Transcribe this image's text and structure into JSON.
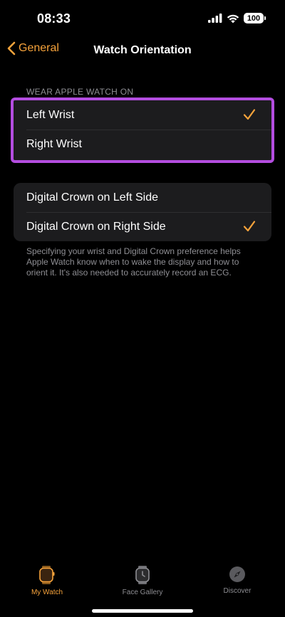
{
  "status": {
    "time": "08:33",
    "battery": "100"
  },
  "nav": {
    "back_label": "General",
    "title": "Watch Orientation"
  },
  "wrist_section": {
    "header": "WEAR APPLE WATCH ON",
    "options": [
      {
        "label": "Left Wrist",
        "selected": true
      },
      {
        "label": "Right Wrist",
        "selected": false
      }
    ]
  },
  "crown_section": {
    "options": [
      {
        "label": "Digital Crown on Left Side",
        "selected": false
      },
      {
        "label": "Digital Crown on Right Side",
        "selected": true
      }
    ],
    "footer": "Specifying your wrist and Digital Crown preference helps Apple Watch know when to wake the display and how to orient it. It's also needed to accurately record an ECG."
  },
  "tabs": [
    {
      "label": "My Watch",
      "icon": "watch-icon",
      "active": true
    },
    {
      "label": "Face Gallery",
      "icon": "face-gallery-icon",
      "active": false
    },
    {
      "label": "Discover",
      "icon": "compass-icon",
      "active": false
    }
  ],
  "colors": {
    "accent": "#f7a33b",
    "highlight": "#b44de0",
    "cell": "#1c1c1e",
    "secondary_text": "#8e8e93"
  }
}
